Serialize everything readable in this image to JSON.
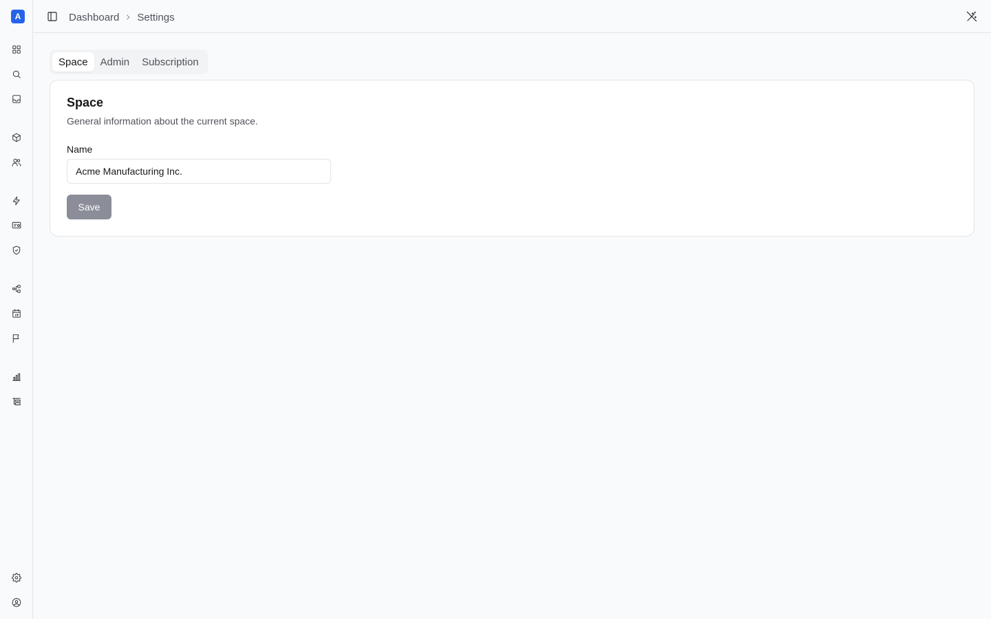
{
  "app": {
    "logo_letter": "A",
    "brand_color": "#2563eb"
  },
  "sidebar": {
    "items": [
      {
        "icon": "grid-icon"
      },
      {
        "icon": "search-icon"
      },
      {
        "icon": "inbox-icon"
      },
      {
        "icon": "package-icon"
      },
      {
        "icon": "users-icon"
      },
      {
        "icon": "zap-icon"
      },
      {
        "icon": "id-card-icon"
      },
      {
        "icon": "shield-check-icon"
      },
      {
        "icon": "workflow-icon"
      },
      {
        "icon": "calendar-icon"
      },
      {
        "icon": "flag-icon"
      },
      {
        "icon": "bar-chart-icon"
      },
      {
        "icon": "list-tree-icon"
      }
    ],
    "bottom_items": [
      {
        "icon": "settings-icon"
      },
      {
        "icon": "user-circle-icon"
      }
    ]
  },
  "header": {
    "breadcrumb": [
      "Dashboard",
      "Settings"
    ]
  },
  "tabs": [
    {
      "label": "Space",
      "active": true
    },
    {
      "label": "Admin",
      "active": false
    },
    {
      "label": "Subscription",
      "active": false
    }
  ],
  "card": {
    "title": "Space",
    "description": "General information about the current space.",
    "name_label": "Name",
    "name_value": "Acme Manufacturing Inc.",
    "save_label": "Save"
  }
}
